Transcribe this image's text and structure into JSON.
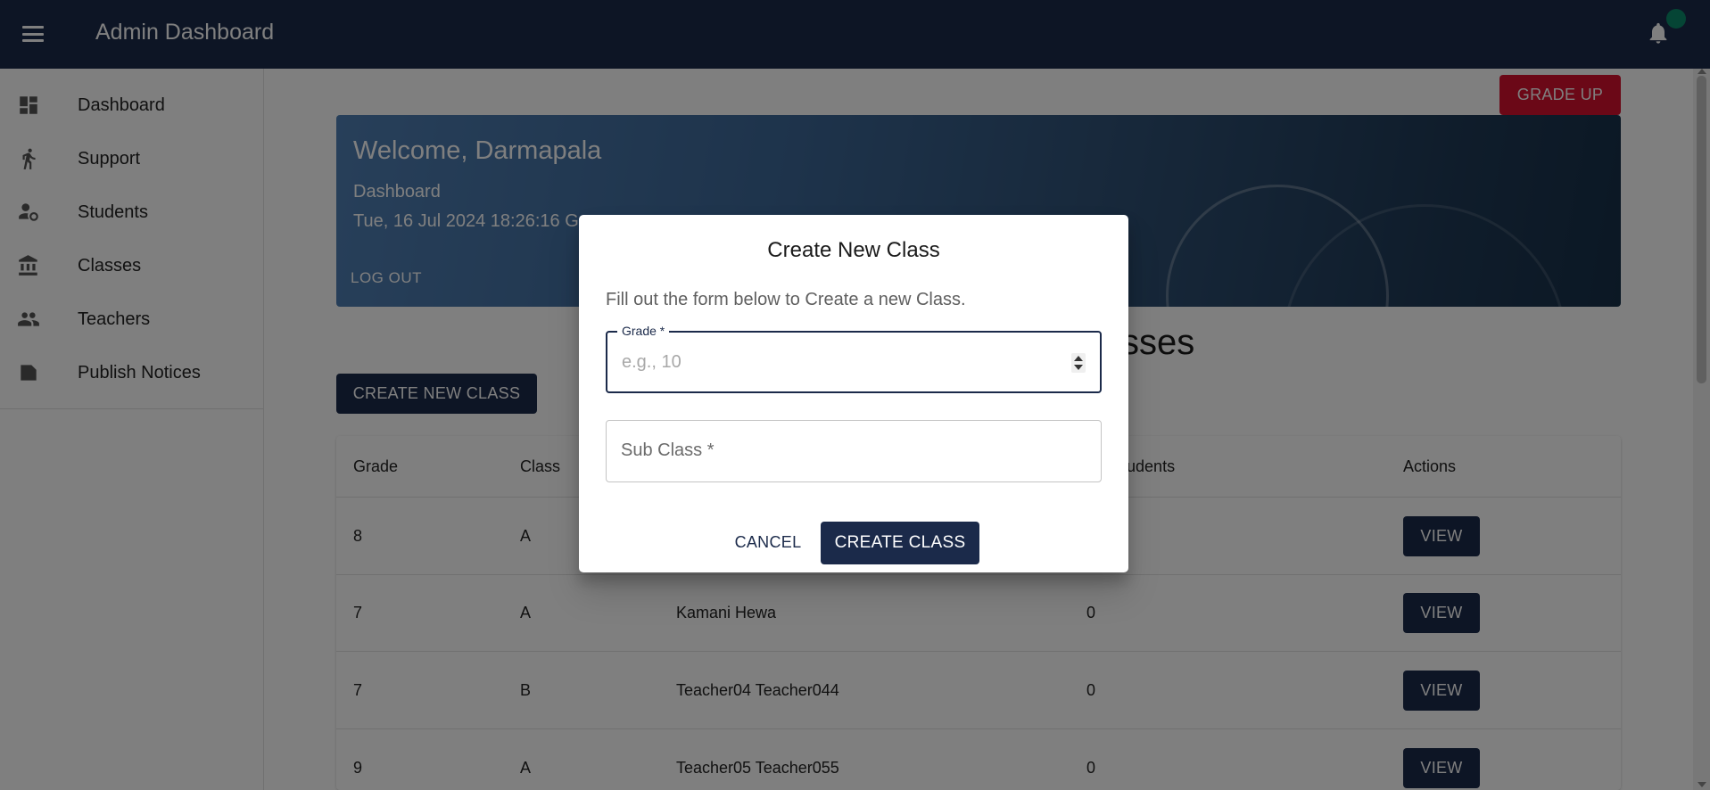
{
  "app": {
    "title": "Admin Dashboard"
  },
  "icons": {
    "menu": "menu-icon",
    "notifications": "bell-icon"
  },
  "colors": {
    "appbar": "#1b2a4a",
    "primary": "#1b2a4a",
    "danger": "#d7102f",
    "avatar": "#0b8a6a"
  },
  "sidebar": {
    "items": [
      {
        "label": "Dashboard",
        "icon": "dashboard-icon"
      },
      {
        "label": "Support",
        "icon": "walking-person-icon"
      },
      {
        "label": "Students",
        "icon": "person-settings-icon"
      },
      {
        "label": "Classes",
        "icon": "institution-icon"
      },
      {
        "label": "Teachers",
        "icon": "people-icon"
      },
      {
        "label": "Publish Notices",
        "icon": "label-icon"
      }
    ]
  },
  "toolbar": {
    "grade_up_label": "GRADE UP"
  },
  "hero": {
    "welcome": "Welcome, Darmapala",
    "subtitle": "Dashboard",
    "datetime": "Tue, 16 Jul 2024 18:26:16 G",
    "logout_label": "LOG OUT"
  },
  "section": {
    "title": "sses"
  },
  "create_new_label": "CREATE NEW CLASS",
  "table": {
    "headers": [
      "Grade",
      "Class",
      "",
      "of Students",
      "Actions"
    ],
    "rows": [
      {
        "grade": "8",
        "class": "A",
        "teacher": "",
        "students": "",
        "action": "VIEW"
      },
      {
        "grade": "7",
        "class": "A",
        "teacher": "Kamani Hewa",
        "students": "0",
        "action": "VIEW"
      },
      {
        "grade": "7",
        "class": "B",
        "teacher": "Teacher04 Teacher044",
        "students": "0",
        "action": "VIEW"
      },
      {
        "grade": "9",
        "class": "A",
        "teacher": "Teacher05 Teacher055",
        "students": "0",
        "action": "VIEW"
      }
    ]
  },
  "dialog": {
    "title": "Create New Class",
    "description": "Fill out the form below to Create a new Class.",
    "grade_label": "Grade *",
    "grade_placeholder": "e.g., 10",
    "subclass_label": "Sub Class *",
    "cancel_label": "CANCEL",
    "submit_label": "CREATE CLASS"
  }
}
